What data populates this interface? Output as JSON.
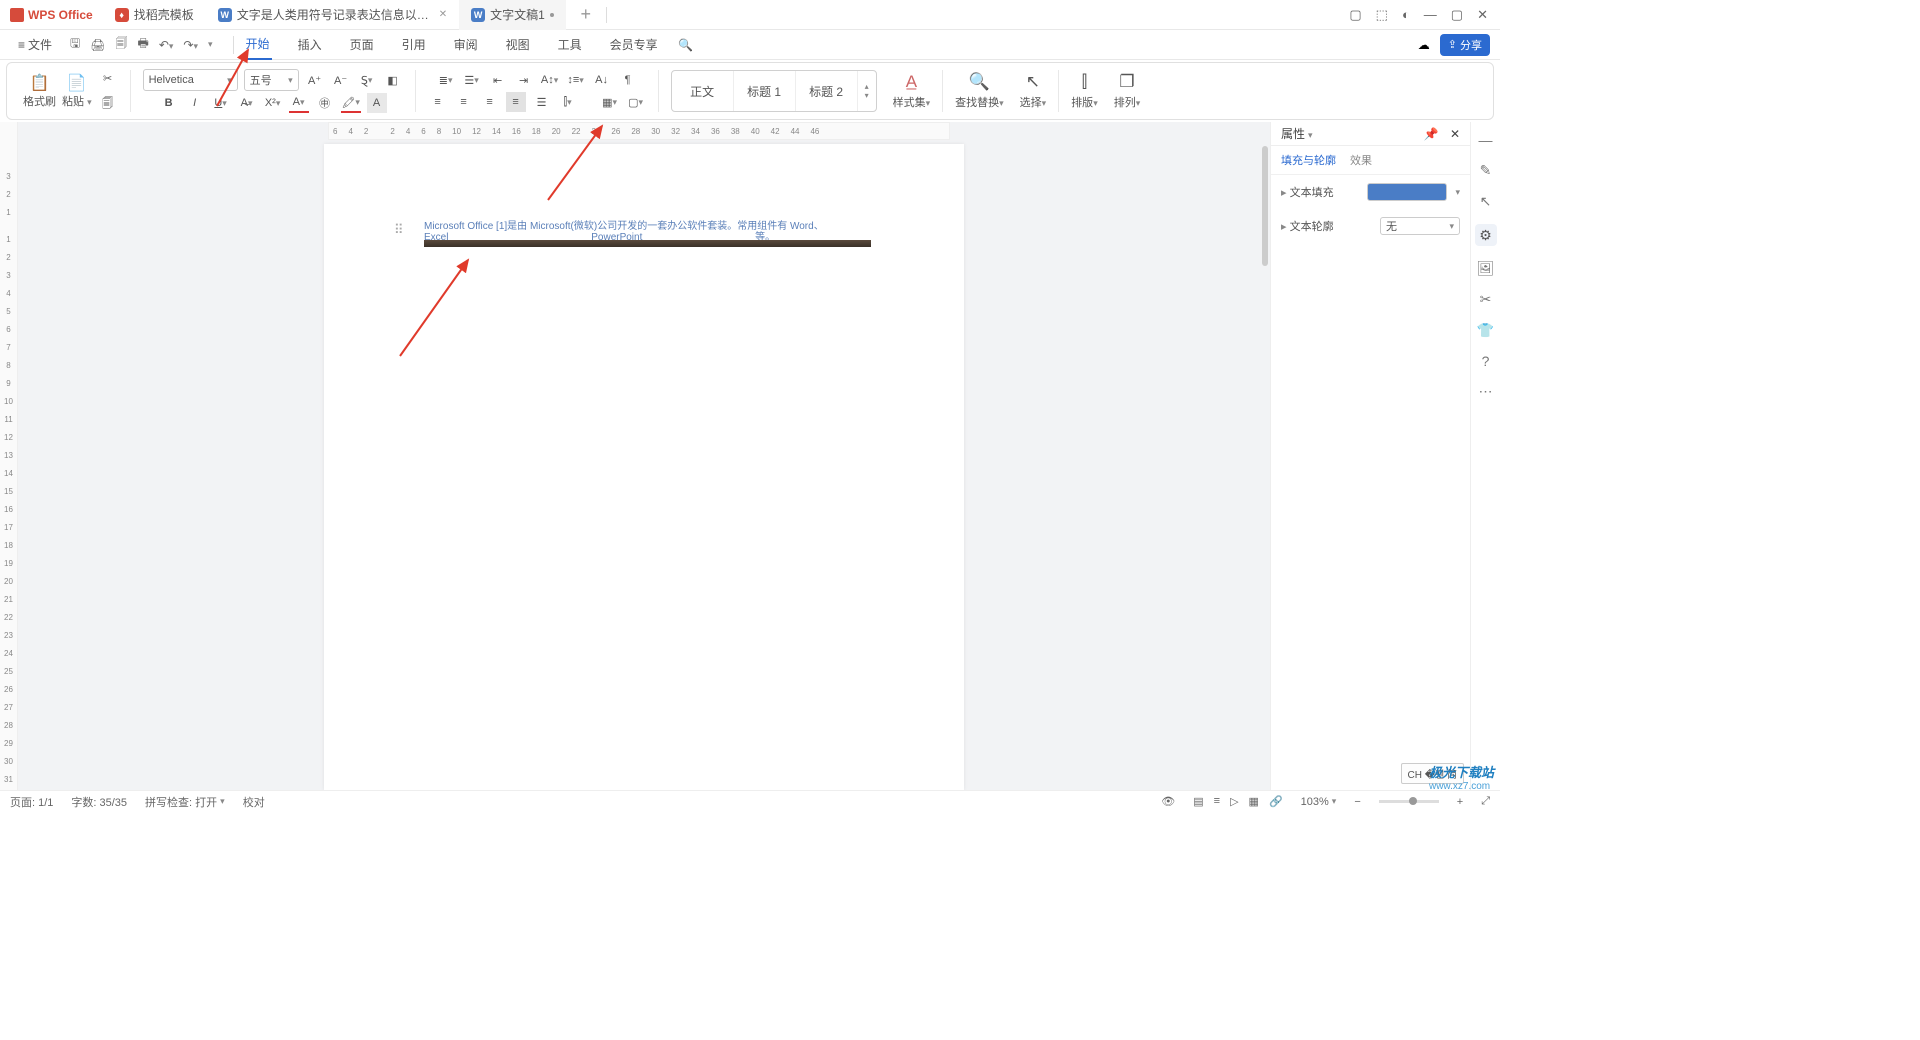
{
  "tabs": {
    "brand": "WPS Office",
    "t1": "找稻壳模板",
    "t2": "文字是人类用符号记录表达信息以…",
    "t3": "文字文稿1"
  },
  "menu": {
    "file": "文件",
    "tabs": [
      "开始",
      "插入",
      "页面",
      "引用",
      "审阅",
      "视图",
      "工具",
      "会员专享"
    ],
    "share": "分享"
  },
  "ribbon": {
    "format_brush": "格式刷",
    "paste": "粘贴",
    "font_name": "Helvetica",
    "font_size": "五号",
    "styles": [
      "正文",
      "标题 1",
      "标题 2"
    ],
    "style_set": "样式集",
    "find_replace": "查找替换",
    "select": "选择",
    "layout": "排版",
    "arrange": "排列"
  },
  "hruler": [
    "6",
    "4",
    "2",
    "",
    "2",
    "4",
    "6",
    "8",
    "10",
    "12",
    "14",
    "16",
    "18",
    "20",
    "22",
    "24",
    "26",
    "28",
    "30",
    "32",
    "34",
    "36",
    "38",
    "40",
    "42",
    "44",
    "46"
  ],
  "vruler": [
    "3",
    "2",
    "1",
    "",
    "1",
    "2",
    "3",
    "4",
    "5",
    "6",
    "7",
    "8",
    "9",
    "10",
    "11",
    "12",
    "13",
    "14",
    "15",
    "16",
    "17",
    "18",
    "19",
    "20",
    "21",
    "22",
    "23",
    "24",
    "25",
    "26",
    "27",
    "28",
    "29",
    "30",
    "31"
  ],
  "doc": {
    "line1a": "Microsoft Office [1]是由",
    "line1b": "Microsoft(微软)公司开发的一套办公软件套装。常用组件有",
    "line1c": "Word、",
    "line2a": "Excel",
    "line2b": "PowerPoint",
    "line2c": "等。"
  },
  "panel": {
    "title": "属性",
    "tab1": "填充与轮廓",
    "tab2": "效果",
    "fill_label": "文本填充",
    "outline_label": "文本轮廓",
    "outline_val": "无"
  },
  "status": {
    "page": "页面: 1/1",
    "words": "字数: 35/35",
    "spell": "拼写检查: 打开",
    "revise": "校对",
    "zoom": "103%"
  },
  "ime": "CH �펜 简",
  "watermark": {
    "a": "极光下载站",
    "b": "www.xz7.com"
  }
}
